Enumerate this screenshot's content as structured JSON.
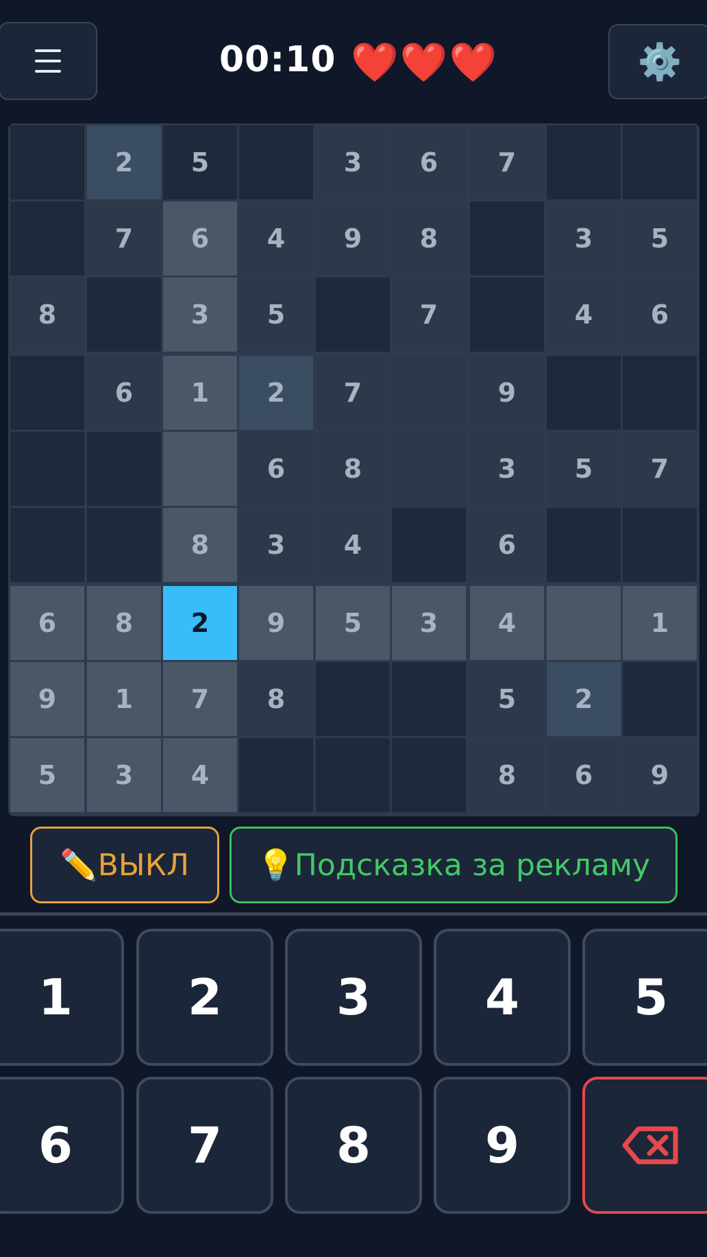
{
  "header": {
    "menu_icon": "hamburger-menu-icon",
    "timer": "00:10",
    "hearts": [
      "❤️",
      "❤️",
      "❤️"
    ],
    "settings_icon": "⚙️"
  },
  "board": {
    "values": [
      [
        "",
        "2",
        "5",
        "",
        "3",
        "6",
        "7",
        "",
        ""
      ],
      [
        "",
        "7",
        "6",
        "4",
        "9",
        "8",
        "",
        "3",
        "5"
      ],
      [
        "8",
        "",
        "3",
        "5",
        "",
        "7",
        "",
        "4",
        "6"
      ],
      [
        "",
        "6",
        "1",
        "2",
        "7",
        "",
        "9",
        "",
        ""
      ],
      [
        "",
        "",
        "",
        "6",
        "8",
        "",
        "3",
        "5",
        "7"
      ],
      [
        "",
        "",
        "8",
        "3",
        "4",
        "",
        "6",
        "",
        ""
      ],
      [
        "6",
        "8",
        "2",
        "9",
        "5",
        "3",
        "4",
        "",
        "1"
      ],
      [
        "9",
        "1",
        "7",
        "8",
        "",
        "",
        "5",
        "2",
        ""
      ],
      [
        "5",
        "3",
        "4",
        "",
        "",
        "",
        "8",
        "6",
        "9"
      ]
    ],
    "selected_cell": {
      "row": 7,
      "col": 3,
      "value": "2"
    },
    "colors": {
      "empty": "#1e293b",
      "filled": "#2d394b",
      "highlight": "#4b5666",
      "same_number": "#3a4d63",
      "selected": "#38bdf8"
    }
  },
  "controls": {
    "pencil_emoji": "✏️",
    "pencil_label": "ВЫКЛ",
    "hint_emoji": "💡",
    "hint_label": "Подсказка за рекламу"
  },
  "keypad": {
    "keys": [
      "1",
      "2",
      "3",
      "4",
      "5",
      "6",
      "7",
      "8",
      "9"
    ],
    "delete_icon": "backspace-icon",
    "delete_color": "#e5484d"
  }
}
